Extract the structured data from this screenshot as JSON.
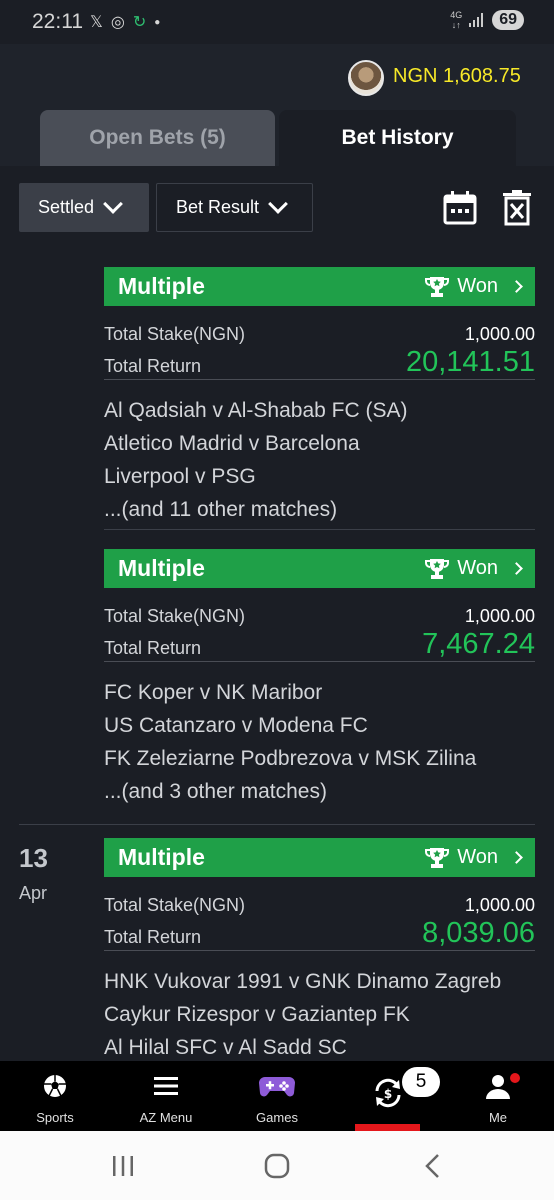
{
  "status_bar": {
    "time": "22:11",
    "network": "4G",
    "battery": "69"
  },
  "header": {
    "balance": "NGN 1,608.75"
  },
  "tabs": [
    {
      "label": "Open Bets (5)",
      "active": false
    },
    {
      "label": "Bet History",
      "active": true
    }
  ],
  "filters": {
    "status": "Settled",
    "result": "Bet Result"
  },
  "bets": [
    {
      "type": "Multiple",
      "status": "Won",
      "stake_label": "Total Stake(NGN)",
      "stake": "1,000.00",
      "return_label": "Total Return",
      "return": "20,141.51",
      "matches": [
        "Al Qadsiah v Al-Shabab FC (SA)",
        "Atletico Madrid v Barcelona",
        "Liverpool v PSG",
        "...(and 11 other matches)"
      ]
    },
    {
      "type": "Multiple",
      "status": "Won",
      "stake_label": "Total Stake(NGN)",
      "stake": "1,000.00",
      "return_label": "Total Return",
      "return": "7,467.24",
      "matches": [
        "FC Koper v NK Maribor",
        "US Catanzaro v Modena FC",
        "FK Zeleziarne Podbrezova v MSK Zilina",
        "...(and 3 other matches)"
      ]
    },
    {
      "date_day": "13",
      "date_month": "Apr",
      "type": "Multiple",
      "status": "Won",
      "stake_label": "Total Stake(NGN)",
      "stake": "1,000.00",
      "return_label": "Total Return",
      "return": "8,039.06",
      "matches": [
        "HNK Vukovar 1991 v GNK Dinamo Zagreb",
        "Caykur Rizespor v Gaziantep FK",
        "Al Hilal SFC v Al Sadd SC"
      ]
    }
  ],
  "bottom_nav": {
    "items": [
      {
        "label": "Sports",
        "icon": "football-icon"
      },
      {
        "label": "AZ Menu",
        "icon": "menu-icon"
      },
      {
        "label": "Games",
        "icon": "gamepad-icon"
      },
      {
        "label": "",
        "icon": "cashout-icon",
        "active": true
      },
      {
        "label": "Me",
        "icon": "user-icon"
      }
    ],
    "badge": "5"
  },
  "colors": {
    "accent_green": "#1fa048",
    "return_green": "#22c459",
    "balance_yellow": "#f7e928",
    "active_red": "#e4171b",
    "background": "#1b1e25"
  }
}
